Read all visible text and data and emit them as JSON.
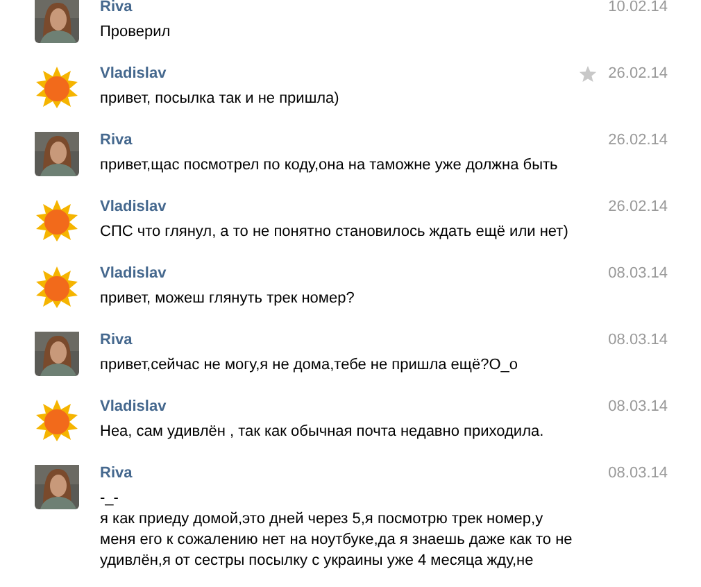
{
  "messages": [
    {
      "author": "Riva",
      "date": "10.02.14",
      "lines": [
        "Проверил"
      ]
    },
    {
      "author": "Vladislav",
      "avatar": {
        "kind": "sun"
      },
      "date": "26.02.14",
      "starred": false,
      "lines": [
        "привет, посылка так и не пришла)"
      ]
    },
    {
      "author": "Riva",
      "date": "26.02.14",
      "lines": [
        "привет,щас посмотрел по коду,она на таможне уже должна быть"
      ]
    },
    {
      "author": "Vladislav",
      "avatar": {
        "kind": "sun"
      },
      "date": "26.02.14",
      "lines": [
        "СПС что глянул, а то не понятно становилось ждать ещё или нет)"
      ]
    },
    {
      "author": "Vladislav",
      "avatar": {
        "kind": "sun"
      },
      "date": "08.03.14",
      "lines": [
        "привет, можеш глянуть трек номер?"
      ]
    },
    {
      "author": "Riva",
      "date": "08.03.14",
      "lines": [
        "привет,сейчас не могу,я не дома,тебе не пришла ещё?О_о"
      ]
    },
    {
      "author": "Vladislav",
      "avatar": {
        "kind": "sun"
      },
      "date": "08.03.14",
      "lines": [
        "Неа, сам удивлён , так как обычная почта недавно приходила."
      ]
    },
    {
      "author": "Riva",
      "date": "08.03.14",
      "lines": [
        "-_-",
        "я как приеду домой,это дней через 5,я посмотрю трек номер,у",
        "меня его к сожалению нет на ноутбуке,да я знаешь даже как то не",
        "удивлён,я от сестры посылку с украины уже 4 месяца жду,не"
      ]
    }
  ]
}
